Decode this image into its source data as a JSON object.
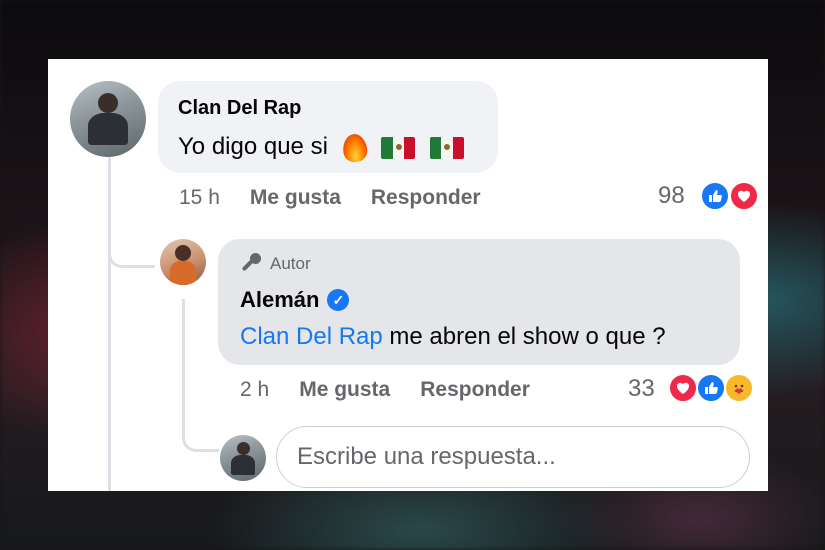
{
  "comment": {
    "author": "Clan Del Rap",
    "text": "Yo digo que si",
    "emojis": [
      "fire-emoji",
      "mexico-flag-emoji",
      "mexico-flag-emoji"
    ],
    "time": "15 h",
    "like_label": "Me gusta",
    "reply_label": "Responder",
    "reaction_count": "98",
    "reactions": [
      "like",
      "love"
    ]
  },
  "reply": {
    "badge": "Autor",
    "author": "Alemán",
    "verified": true,
    "mention": "Clan Del Rap",
    "text": " me abren el show o que ?",
    "time": "2 h",
    "like_label": "Me gusta",
    "reply_label": "Responder",
    "reaction_count": "33",
    "reactions": [
      "love",
      "like",
      "care"
    ]
  },
  "composer": {
    "placeholder": "Escribe una respuesta..."
  },
  "colors": {
    "like": "#1877f2",
    "love": "#f02849",
    "care": "#f7b928",
    "mention": "#1877f2",
    "meta": "#65676b"
  }
}
